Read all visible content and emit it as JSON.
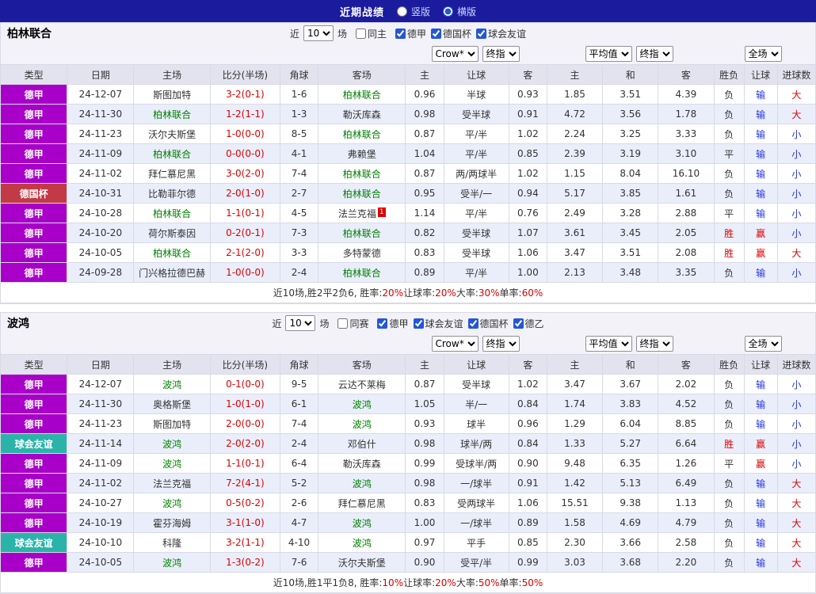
{
  "topbar": {
    "title": "近期战绩",
    "vertical": "竖版",
    "horizontal": "横版"
  },
  "colors": {
    "topbar_bg": "#1b1b9e",
    "accent": "#2356d8",
    "team_green": "#008000",
    "score_red": "#dd0000",
    "blue": "#2233dd",
    "league": {
      "德甲": "#a800c8",
      "德国杯": "#c13a45",
      "球会友谊": "#2bb3aa"
    },
    "result": {
      "胜": "#dd0000",
      "平": "#333333",
      "负": "#333333",
      "赢": "#dd0000",
      "输": "#2233dd",
      "大": "#dd0000",
      "小": "#2233dd"
    }
  },
  "sections": [
    {
      "team": "柏林联合",
      "filters": {
        "near": "近",
        "count": "10",
        "games": "场",
        "same": "同主",
        "leagues": [
          "德甲",
          "德国杯",
          "球会友谊"
        ]
      },
      "dropdowns": {
        "company": "Crow*",
        "final_a": "终指",
        "average": "平均值",
        "final_b": "终指",
        "scope": "全场"
      },
      "headers": [
        "类型",
        "日期",
        "主场",
        "比分(半场)",
        "角球",
        "客场",
        "主",
        "让球",
        "客",
        "主",
        "和",
        "客",
        "胜负",
        "让球",
        "进球数"
      ],
      "rows": [
        {
          "league": "德甲",
          "date": "24-12-07",
          "home": "斯图加特",
          "score": "3-2(0-1)",
          "corners": "1-6",
          "away": "柏林联合",
          "odds": [
            "0.96",
            "半球",
            "0.93"
          ],
          "avg": [
            "1.85",
            "3.51",
            "4.39"
          ],
          "results": [
            "负",
            "输",
            "大"
          ]
        },
        {
          "league": "德甲",
          "date": "24-11-30",
          "home": "柏林联合",
          "score": "1-2(1-1)",
          "corners": "1-3",
          "away": "勒沃库森",
          "odds": [
            "0.98",
            "受半球",
            "0.91"
          ],
          "avg": [
            "4.72",
            "3.56",
            "1.78"
          ],
          "results": [
            "负",
            "输",
            "大"
          ]
        },
        {
          "league": "德甲",
          "date": "24-11-23",
          "home": "沃尔夫斯堡",
          "score": "1-0(0-0)",
          "corners": "8-5",
          "away": "柏林联合",
          "odds": [
            "0.87",
            "平/半",
            "1.02"
          ],
          "avg": [
            "2.24",
            "3.25",
            "3.33"
          ],
          "results": [
            "负",
            "输",
            "小"
          ]
        },
        {
          "league": "德甲",
          "date": "24-11-09",
          "home": "柏林联合",
          "score": "0-0(0-0)",
          "corners": "4-1",
          "away": "弗赖堡",
          "odds": [
            "1.04",
            "平/半",
            "0.85"
          ],
          "avg": [
            "2.39",
            "3.19",
            "3.10"
          ],
          "results": [
            "平",
            "输",
            "小"
          ]
        },
        {
          "league": "德甲",
          "date": "24-11-02",
          "home": "拜仁慕尼黑",
          "score": "3-0(2-0)",
          "corners": "7-4",
          "away": "柏林联合",
          "odds": [
            "0.87",
            "两/两球半",
            "1.02"
          ],
          "avg": [
            "1.15",
            "8.04",
            "16.10"
          ],
          "results": [
            "负",
            "输",
            "小"
          ]
        },
        {
          "league": "德国杯",
          "date": "24-10-31",
          "home": "比勒菲尔德",
          "score": "2-0(1-0)",
          "corners": "2-7",
          "away": "柏林联合",
          "odds": [
            "0.95",
            "受半/一",
            "0.94"
          ],
          "avg": [
            "5.17",
            "3.85",
            "1.61"
          ],
          "results": [
            "负",
            "输",
            "小"
          ]
        },
        {
          "league": "德甲",
          "date": "24-10-28",
          "home": "柏林联合",
          "score": "1-1(0-1)",
          "corners": "4-5",
          "away": "法兰克福",
          "away_note": "1",
          "odds": [
            "1.14",
            "平/半",
            "0.76"
          ],
          "avg": [
            "2.49",
            "3.28",
            "2.88"
          ],
          "results": [
            "平",
            "输",
            "小"
          ]
        },
        {
          "league": "德甲",
          "date": "24-10-20",
          "home": "荷尔斯泰因",
          "score": "0-2(0-1)",
          "corners": "7-3",
          "away": "柏林联合",
          "odds": [
            "0.82",
            "受半球",
            "1.07"
          ],
          "avg": [
            "3.61",
            "3.45",
            "2.05"
          ],
          "results": [
            "胜",
            "赢",
            "小"
          ]
        },
        {
          "league": "德甲",
          "date": "24-10-05",
          "home": "柏林联合",
          "score": "2-1(2-0)",
          "corners": "3-3",
          "away": "多特蒙德",
          "odds": [
            "0.83",
            "受半球",
            "1.06"
          ],
          "avg": [
            "3.47",
            "3.51",
            "2.08"
          ],
          "results": [
            "胜",
            "赢",
            "大"
          ]
        },
        {
          "league": "德甲",
          "date": "24-09-28",
          "home": "门兴格拉德巴赫",
          "score": "1-0(0-0)",
          "corners": "2-4",
          "away": "柏林联合",
          "odds": [
            "0.89",
            "平/半",
            "1.00"
          ],
          "avg": [
            "2.13",
            "3.48",
            "3.35"
          ],
          "results": [
            "负",
            "输",
            "小"
          ]
        }
      ],
      "summary": [
        {
          "text": "近10场,胜2平2负6, 胜率:",
          "red": false
        },
        {
          "text": "20%",
          "red": true
        },
        {
          "text": " 让球率:",
          "red": false
        },
        {
          "text": "20%",
          "red": true
        },
        {
          "text": " 大率:",
          "red": false
        },
        {
          "text": "30%",
          "red": true
        },
        {
          "text": " 单率:",
          "red": false
        },
        {
          "text": "60%",
          "red": true
        }
      ]
    },
    {
      "team": "波鸿",
      "filters": {
        "near": "近",
        "count": "10",
        "games": "场",
        "same": "同赛",
        "leagues": [
          "德甲",
          "球会友谊",
          "德国杯",
          "德乙"
        ]
      },
      "dropdowns": {
        "company": "Crow*",
        "final_a": "终指",
        "average": "平均值",
        "final_b": "终指",
        "scope": "全场"
      },
      "headers": [
        "类型",
        "日期",
        "主场",
        "比分(半场)",
        "角球",
        "客场",
        "主",
        "让球",
        "客",
        "主",
        "和",
        "客",
        "胜负",
        "让球",
        "进球数"
      ],
      "rows": [
        {
          "league": "德甲",
          "date": "24-12-07",
          "home": "波鸿",
          "score": "0-1(0-0)",
          "corners": "9-5",
          "away": "云达不莱梅",
          "odds": [
            "0.87",
            "受半球",
            "1.02"
          ],
          "avg": [
            "3.47",
            "3.67",
            "2.02"
          ],
          "results": [
            "负",
            "输",
            "小"
          ]
        },
        {
          "league": "德甲",
          "date": "24-11-30",
          "home": "奥格斯堡",
          "score": "1-0(1-0)",
          "corners": "6-1",
          "away": "波鸿",
          "odds": [
            "1.05",
            "半/一",
            "0.84"
          ],
          "avg": [
            "1.74",
            "3.83",
            "4.52"
          ],
          "results": [
            "负",
            "输",
            "小"
          ]
        },
        {
          "league": "德甲",
          "date": "24-11-23",
          "home": "斯图加特",
          "score": "2-0(0-0)",
          "corners": "7-4",
          "away": "波鸿",
          "odds": [
            "0.93",
            "球半",
            "0.96"
          ],
          "avg": [
            "1.29",
            "6.04",
            "8.85"
          ],
          "results": [
            "负",
            "输",
            "小"
          ]
        },
        {
          "league": "球会友谊",
          "date": "24-11-14",
          "home": "波鸿",
          "score": "2-0(2-0)",
          "corners": "2-4",
          "away": "邓伯什",
          "odds": [
            "0.98",
            "球半/两",
            "0.84"
          ],
          "avg": [
            "1.33",
            "5.27",
            "6.64"
          ],
          "results": [
            "胜",
            "赢",
            "小"
          ]
        },
        {
          "league": "德甲",
          "date": "24-11-09",
          "home": "波鸿",
          "score": "1-1(0-1)",
          "corners": "6-4",
          "away": "勒沃库森",
          "odds": [
            "0.99",
            "受球半/两",
            "0.90"
          ],
          "avg": [
            "9.48",
            "6.35",
            "1.26"
          ],
          "results": [
            "平",
            "赢",
            "小"
          ]
        },
        {
          "league": "德甲",
          "date": "24-11-02",
          "home": "法兰克福",
          "score": "7-2(4-1)",
          "corners": "5-2",
          "away": "波鸿",
          "odds": [
            "0.98",
            "一/球半",
            "0.91"
          ],
          "avg": [
            "1.42",
            "5.13",
            "6.49"
          ],
          "results": [
            "负",
            "输",
            "大"
          ]
        },
        {
          "league": "德甲",
          "date": "24-10-27",
          "home": "波鸿",
          "score": "0-5(0-2)",
          "corners": "2-6",
          "away": "拜仁慕尼黑",
          "odds": [
            "0.83",
            "受两球半",
            "1.06"
          ],
          "avg": [
            "15.51",
            "9.38",
            "1.13"
          ],
          "results": [
            "负",
            "输",
            "大"
          ]
        },
        {
          "league": "德甲",
          "date": "24-10-19",
          "home": "霍芬海姆",
          "score": "3-1(1-0)",
          "corners": "4-7",
          "away": "波鸿",
          "odds": [
            "1.00",
            "一/球半",
            "0.89"
          ],
          "avg": [
            "1.58",
            "4.69",
            "4.79"
          ],
          "results": [
            "负",
            "输",
            "大"
          ]
        },
        {
          "league": "球会友谊",
          "date": "24-10-10",
          "home": "科隆",
          "score": "3-2(1-1)",
          "corners": "4-10",
          "away": "波鸿",
          "odds": [
            "0.97",
            "平手",
            "0.85"
          ],
          "avg": [
            "2.30",
            "3.66",
            "2.58"
          ],
          "results": [
            "负",
            "输",
            "大"
          ]
        },
        {
          "league": "德甲",
          "date": "24-10-05",
          "home": "波鸿",
          "score": "1-3(0-2)",
          "corners": "7-6",
          "away": "沃尔夫斯堡",
          "odds": [
            "0.90",
            "受平/半",
            "0.99"
          ],
          "avg": [
            "3.03",
            "3.68",
            "2.20"
          ],
          "results": [
            "负",
            "输",
            "大"
          ]
        }
      ],
      "summary": [
        {
          "text": "近10场,胜1平1负8, 胜率:",
          "red": false
        },
        {
          "text": "10%",
          "red": true
        },
        {
          "text": " 让球率:",
          "red": false
        },
        {
          "text": "20%",
          "red": true
        },
        {
          "text": " 大率:",
          "red": false
        },
        {
          "text": "50%",
          "red": true
        },
        {
          "text": " 单率:",
          "red": false
        },
        {
          "text": "50%",
          "red": true
        }
      ]
    }
  ]
}
